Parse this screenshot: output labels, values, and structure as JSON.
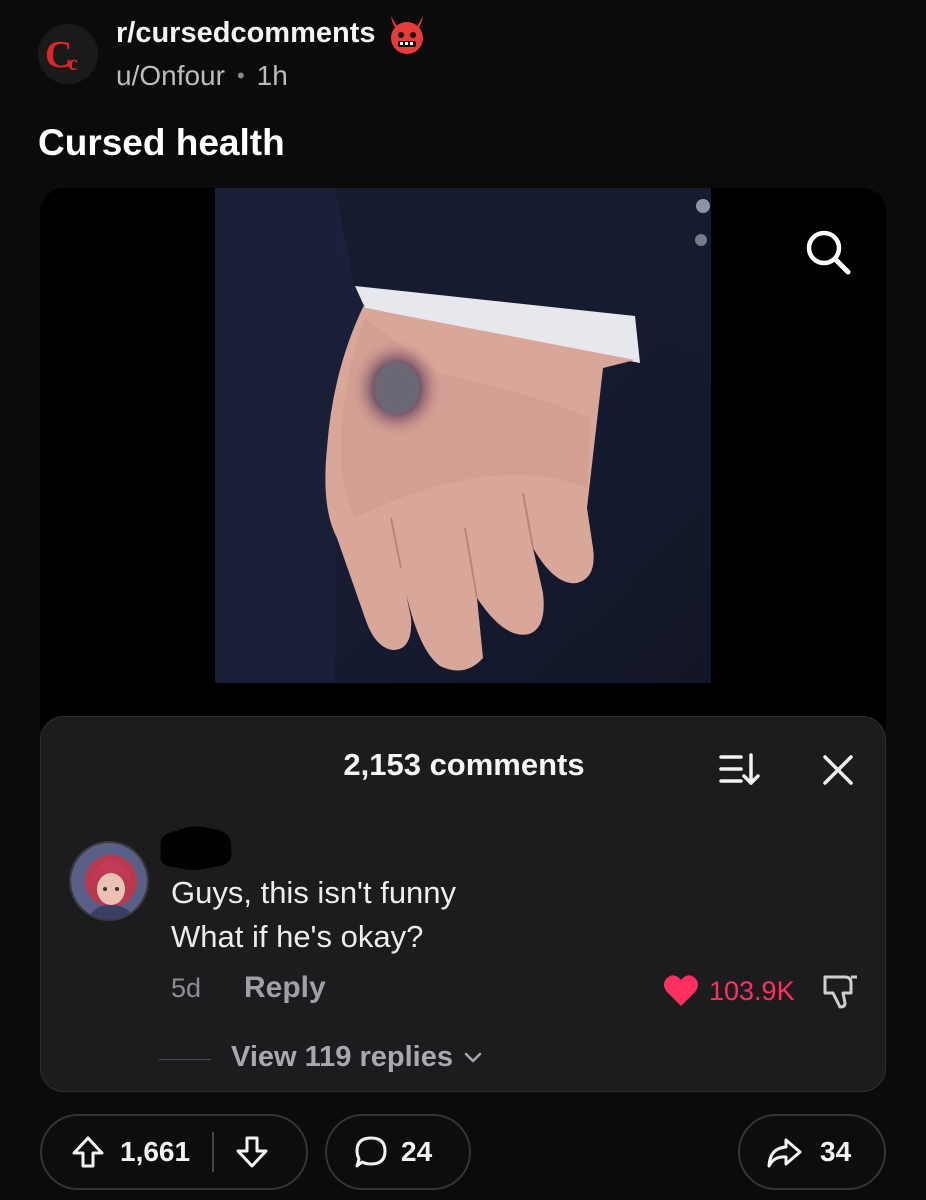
{
  "post": {
    "subreddit": "r/cursedcomments",
    "subreddit_logo_letters": "Cc",
    "author": "u/Onfour",
    "age": "1h",
    "title": "Cursed health"
  },
  "media": {
    "zoom_icon": "search-icon"
  },
  "comments_sheet": {
    "count_label": "2,153 comments",
    "sort_icon": "sort-icon",
    "close_icon": "close-icon",
    "comment": {
      "lines": [
        "Guys, this isn't funny",
        "What if he's okay?"
      ],
      "age": "5d",
      "reply_label": "Reply",
      "likes": "103.9K",
      "view_replies": "View 119 replies"
    }
  },
  "actions": {
    "upvotes": "1,661",
    "comments": "24",
    "shares": "34"
  },
  "colors": {
    "background": "#0b0b0c",
    "sheet": "#1c1c1e",
    "like": "#ff3060",
    "logo_red": "#e02525"
  }
}
